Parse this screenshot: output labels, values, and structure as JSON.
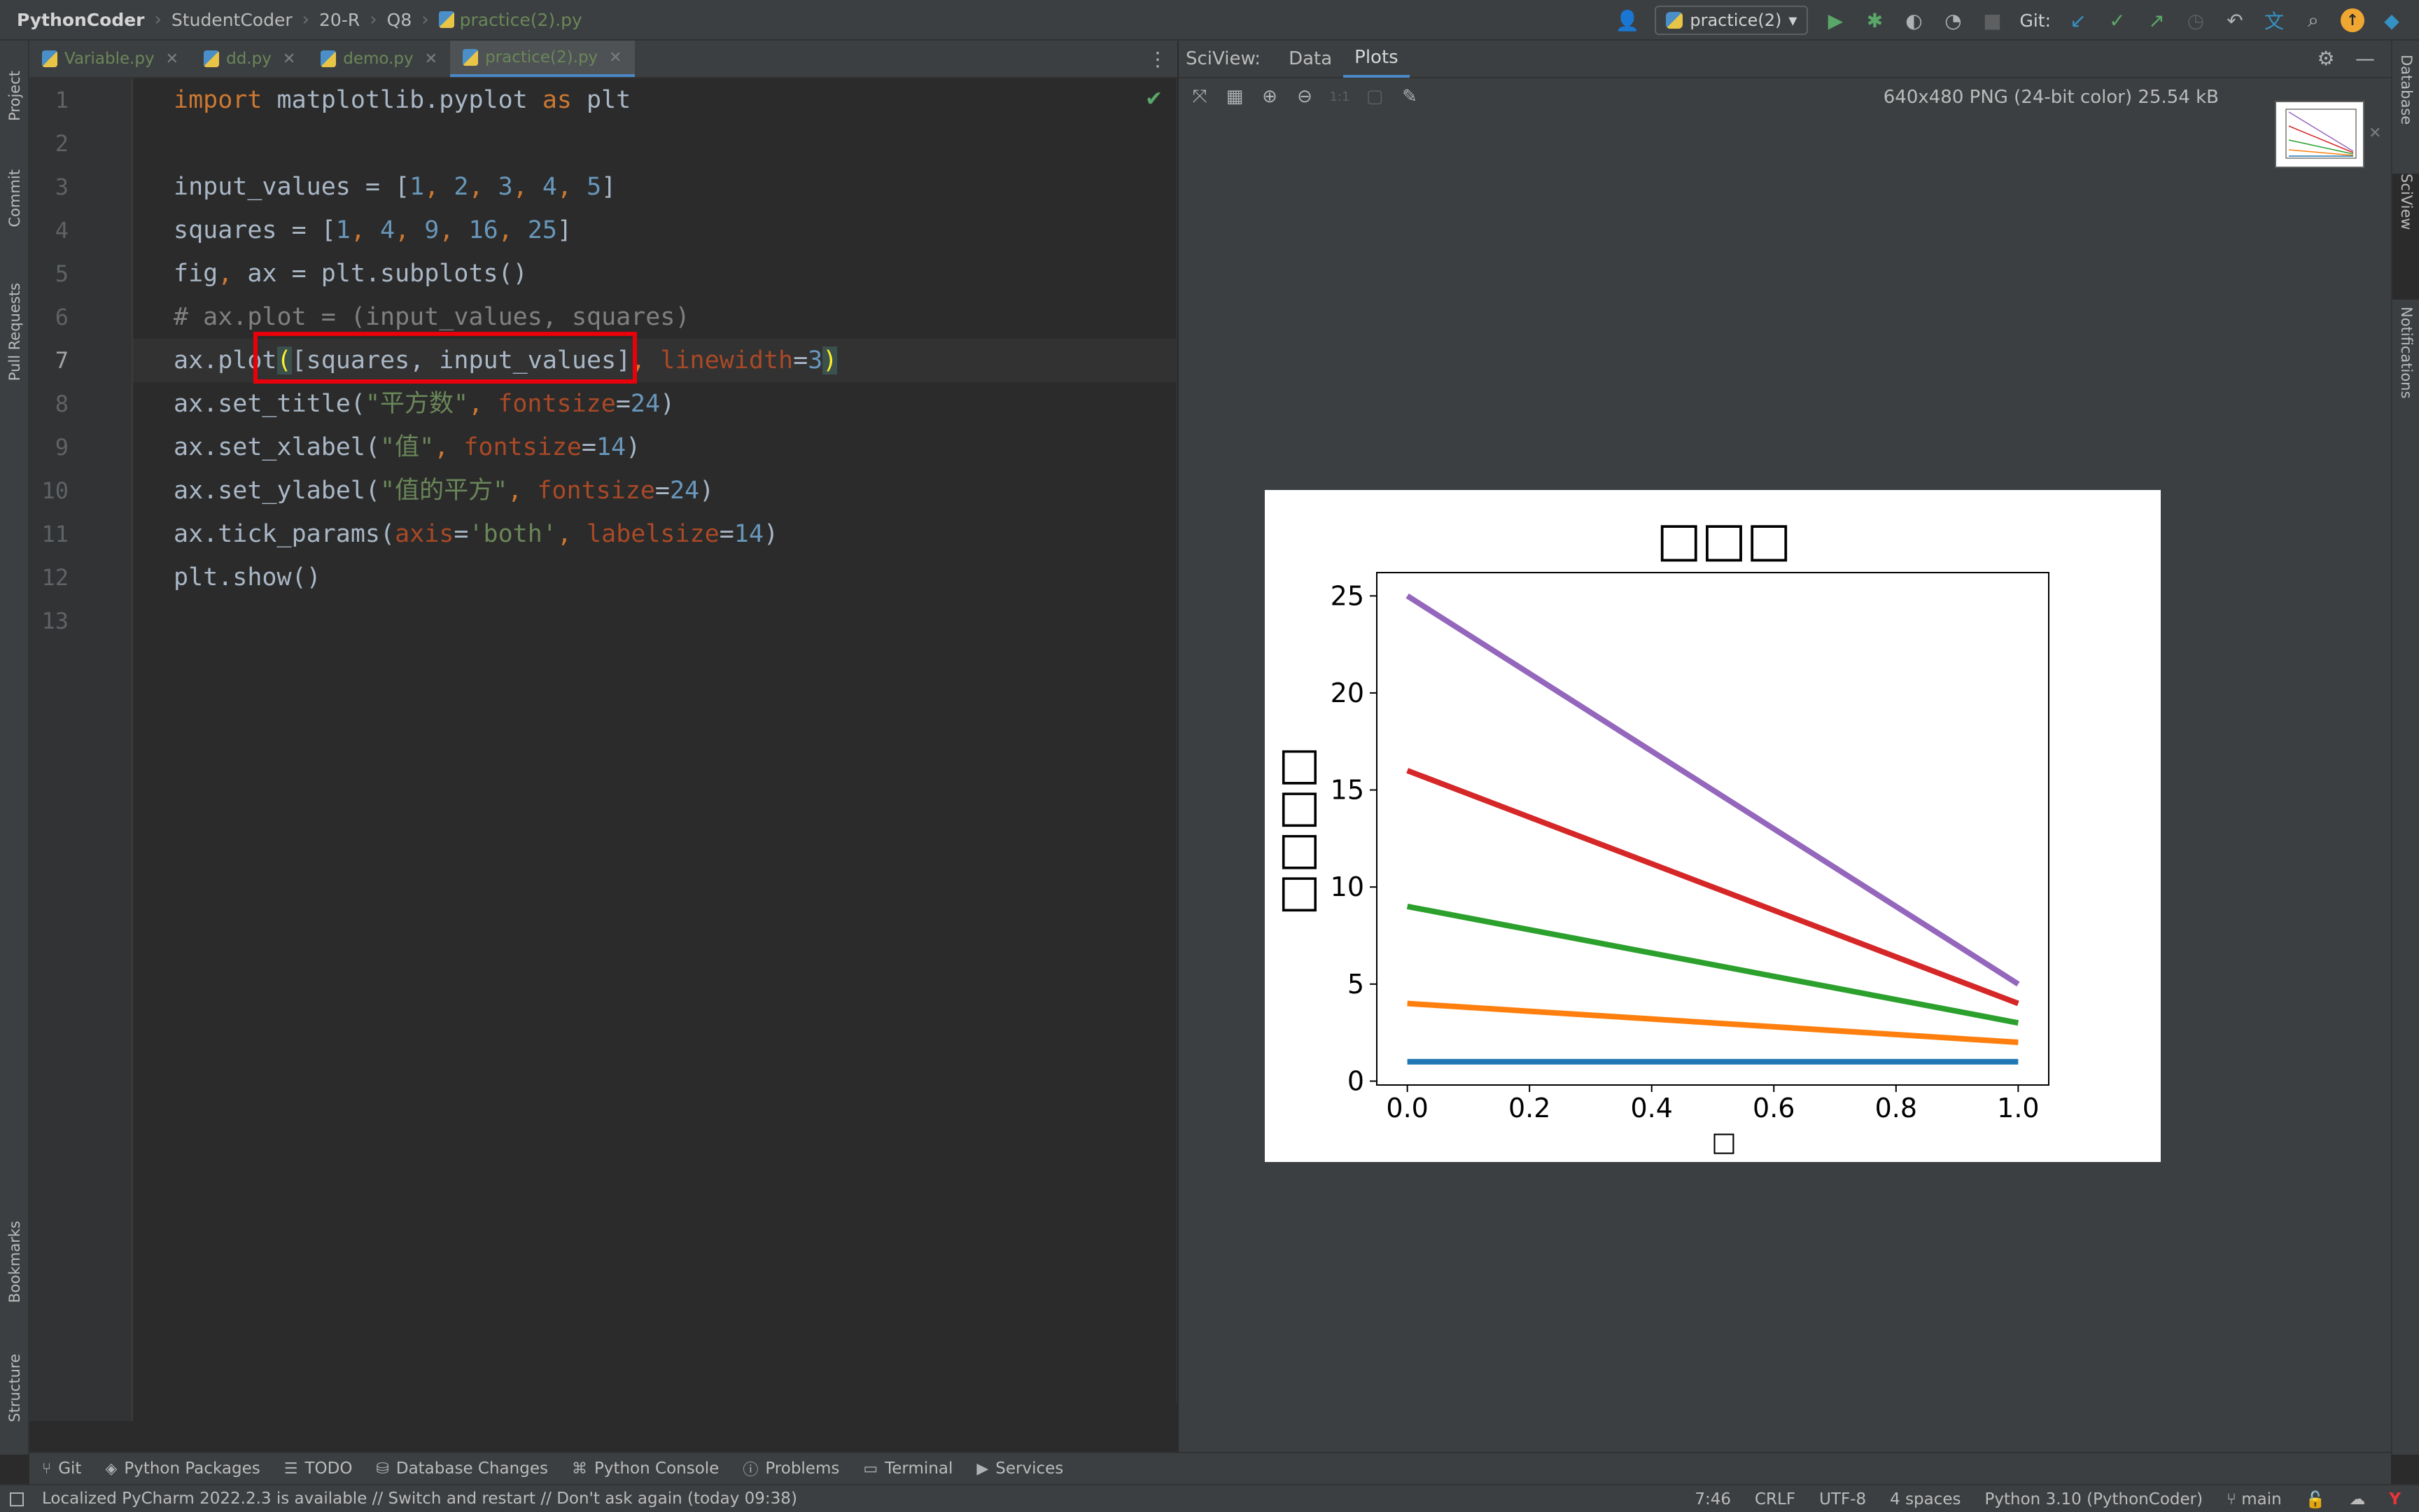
{
  "breadcrumbs": [
    "PythonCoder",
    "StudentCoder",
    "20-R",
    "Q8",
    "practice(2).py"
  ],
  "run_config": "practice(2)",
  "git_label": "Git:",
  "left_tools": [
    "Project",
    "Commit",
    "Pull Requests",
    "Bookmarks",
    "Structure"
  ],
  "right_tools": [
    "Database",
    "SciView",
    "Notifications"
  ],
  "tabs": [
    {
      "label": "Variable.py"
    },
    {
      "label": "dd.py"
    },
    {
      "label": "demo.py"
    },
    {
      "label": "practice(2).py"
    }
  ],
  "line_numbers": [
    "1",
    "2",
    "3",
    "4",
    "5",
    "6",
    "7",
    "8",
    "9",
    "10",
    "11",
    "12",
    "13"
  ],
  "code": {
    "l1": {
      "kw1": "import",
      "mid": " matplotlib.pyplot ",
      "kw2": "as",
      "end": " plt"
    },
    "l3": {
      "start": "input_values = [",
      "n1": "1",
      "c1": ", ",
      "n2": "2",
      "c2": ", ",
      "n3": "3",
      "c3": ", ",
      "n4": "4",
      "c4": ", ",
      "n5": "5",
      "end": "]"
    },
    "l4": {
      "start": "squares = [",
      "n1": "1",
      "c1": ", ",
      "n2": "4",
      "c2": ", ",
      "n3": "9",
      "c3": ", ",
      "n4": "16",
      "c4": ", ",
      "n5": "25",
      "end": "]"
    },
    "l5": {
      "a": "fig",
      "b": ", ",
      "c": "ax = plt.subplots()"
    },
    "l6": {
      "comment": "# ax.plot = (input_values, squares)"
    },
    "l7": {
      "a": "ax.plot",
      "open": "(",
      "b": "[squares, input_values]",
      "c": ", ",
      "param": "linewidth",
      "eq": "=",
      "num": "3",
      "close": ")"
    },
    "l8": {
      "a": "ax.set_title(",
      "str": "\"平方数\"",
      "c": ", ",
      "param": "fontsize",
      "eq": "=",
      "num": "24",
      "end": ")"
    },
    "l9": {
      "a": "ax.set_xlabel(",
      "str": "\"值\"",
      "c": ", ",
      "param": "fontsize",
      "eq": "=",
      "num": "14",
      "end": ")"
    },
    "l10": {
      "a": "ax.set_ylabel(",
      "str": "\"值的平方\"",
      "c": ", ",
      "param": "fontsize",
      "eq": "=",
      "num": "24",
      "end": ")"
    },
    "l11": {
      "a": "ax.tick_params(",
      "param1": "axis",
      "eq1": "=",
      "str": "'both'",
      "c": ", ",
      "param2": "labelsize",
      "eq2": "=",
      "num": "14",
      "end": ")"
    },
    "l12": {
      "a": "plt.show()"
    }
  },
  "sciview": {
    "title": "SciView:",
    "tabs": [
      "Data",
      "Plots"
    ],
    "image_info": "640x480 PNG (24-bit color) 25.54 kB"
  },
  "chart_data": {
    "type": "line",
    "title": "□□□",
    "xlabel": "□",
    "ylabel": "□□□□",
    "x": [
      0.0,
      1.0
    ],
    "xlim": [
      -0.05,
      1.05
    ],
    "ylim": [
      -0.2,
      26.2
    ],
    "x_ticks": [
      "0.0",
      "0.2",
      "0.4",
      "0.6",
      "0.8",
      "1.0"
    ],
    "y_ticks": [
      "0",
      "5",
      "10",
      "15",
      "20",
      "25"
    ],
    "grid": false,
    "series": [
      {
        "color": "#1f77b4",
        "values": [
          1,
          1
        ]
      },
      {
        "color": "#ff7f0e",
        "values": [
          4,
          2
        ]
      },
      {
        "color": "#2ca02c",
        "values": [
          9,
          3
        ]
      },
      {
        "color": "#d62728",
        "values": [
          16,
          4
        ]
      },
      {
        "color": "#9467bd",
        "values": [
          25,
          5
        ]
      }
    ]
  },
  "bottom_tools": [
    "Git",
    "Python Packages",
    "TODO",
    "Database Changes",
    "Python Console",
    "Problems",
    "Terminal",
    "Services"
  ],
  "status": {
    "message": "Localized PyCharm 2022.2.3 is available // Switch and restart // Don't ask again (today 09:38)",
    "position": "7:46",
    "line_sep": "CRLF",
    "encoding": "UTF-8",
    "indent": "4 spaces",
    "interpreter": "Python 3.10 (PythonCoder)",
    "branch": "main"
  }
}
